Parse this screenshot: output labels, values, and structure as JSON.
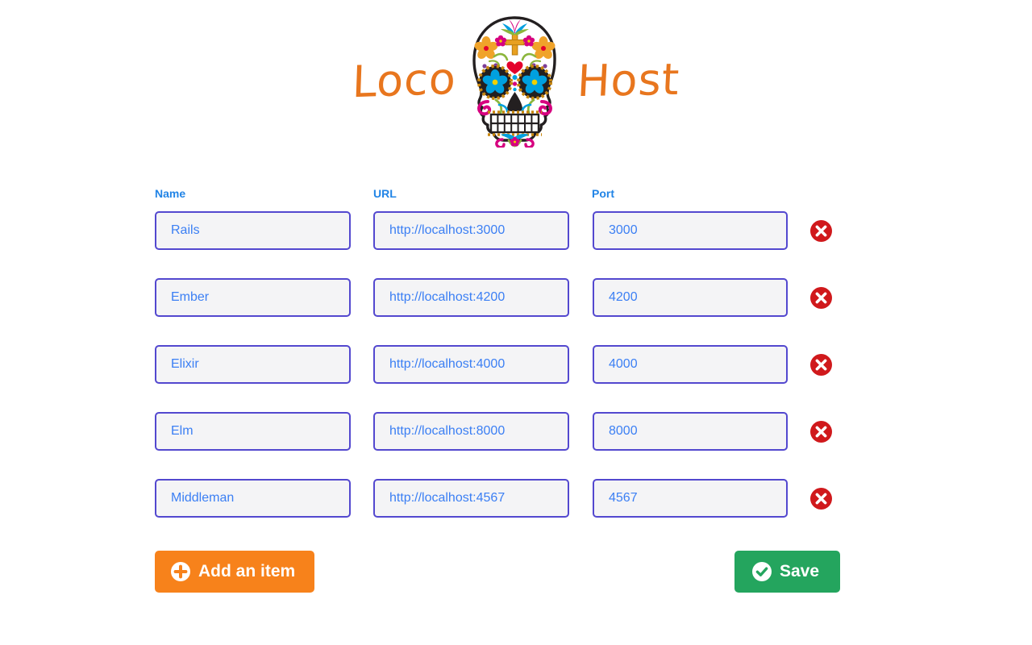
{
  "app": {
    "logo_left": "Loco",
    "logo_right": "Host",
    "logo_icon": "sugar-skull-icon",
    "brand_color": "#e8761e"
  },
  "table": {
    "headers": {
      "name": "Name",
      "url": "URL",
      "port": "Port"
    },
    "header_color": "#2184e6",
    "input_border_color": "#5348cf",
    "input_bg_color": "#f4f4f6",
    "input_text_color": "#3b7ff4",
    "rows": [
      {
        "name": "Rails",
        "url": "http://localhost:3000",
        "port": "3000",
        "delete_icon": "delete-circle-icon"
      },
      {
        "name": "Ember",
        "url": "http://localhost:4200",
        "port": "4200",
        "delete_icon": "delete-circle-icon"
      },
      {
        "name": "Elixir",
        "url": "http://localhost:4000",
        "port": "4000",
        "delete_icon": "delete-circle-icon"
      },
      {
        "name": "Elm",
        "url": "http://localhost:8000",
        "port": "8000",
        "delete_icon": "delete-circle-icon"
      },
      {
        "name": "Middleman",
        "url": "http://localhost:4567",
        "port": "4567",
        "delete_icon": "delete-circle-icon"
      }
    ],
    "placeholders": {
      "name": "Name",
      "url": "URL",
      "port": "Port"
    }
  },
  "footer": {
    "add_label": "Add an item",
    "add_icon": "plus-circle-icon",
    "add_color": "#f7821b",
    "save_label": "Save",
    "save_icon": "check-circle-icon",
    "save_color": "#24a55e"
  },
  "delete_color": "#d0191c"
}
